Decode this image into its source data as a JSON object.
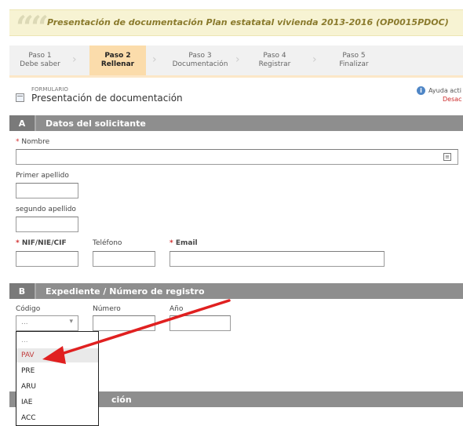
{
  "banner": {
    "title": "Presentación de documentación Plan estatatal vivienda 2013-2016 (OP0015PDOC)"
  },
  "steps": [
    {
      "line1": "Paso 1",
      "line2": "Debe saber",
      "active": false
    },
    {
      "line1": "Paso 2",
      "line2": "Rellenar",
      "active": true
    },
    {
      "line1": "Paso 3",
      "line2": "Documentación",
      "active": false
    },
    {
      "line1": "Paso 4",
      "line2": "Registrar",
      "active": false
    },
    {
      "line1": "Paso 5",
      "line2": "Finalizar",
      "active": false
    }
  ],
  "form": {
    "kicker": "FORMULARIO",
    "title": "Presentación de documentación",
    "help_label": "Ayuda acti",
    "help_status": "Desac"
  },
  "section_a": {
    "letter": "A",
    "title": "Datos del solicitante",
    "fields": {
      "nombre": {
        "label": "Nombre",
        "required": "*",
        "value": ""
      },
      "primer_apellido": {
        "label": "Primer apellido",
        "value": ""
      },
      "segundo_apellido": {
        "label": "segundo apellido",
        "value": ""
      },
      "nif": {
        "label": "NIF/NIE/CIF",
        "required": "*",
        "value": ""
      },
      "telefono": {
        "label": "Teléfono",
        "value": ""
      },
      "email": {
        "label": "Email",
        "required": "*",
        "value": ""
      }
    }
  },
  "section_b": {
    "letter": "B",
    "title": "Expediente / Número de registro",
    "fields": {
      "codigo": {
        "label": "Código",
        "selected": "...",
        "options": [
          "...",
          "PAV",
          "PRE",
          "ARU",
          "IAE",
          "ACC"
        ],
        "highlighted": "PAV"
      },
      "numero": {
        "label": "Número",
        "value": ""
      },
      "anio": {
        "label": "Año",
        "value": ""
      }
    }
  },
  "section_c": {
    "title": "ción"
  },
  "colors": {
    "banner_bg": "#f7f3d3",
    "banner_text": "#8a7a2c",
    "step_active_bg": "#fbdcab",
    "section_bg": "#8e8e8e",
    "required": "#d23030",
    "arrow": "#e02020"
  },
  "icons": {
    "quote": "quote-icon",
    "form": "form-icon",
    "help": "info-icon",
    "search": "search-icon",
    "chevron": "chevron-down-icon",
    "annotation": "arrow-annotation"
  }
}
